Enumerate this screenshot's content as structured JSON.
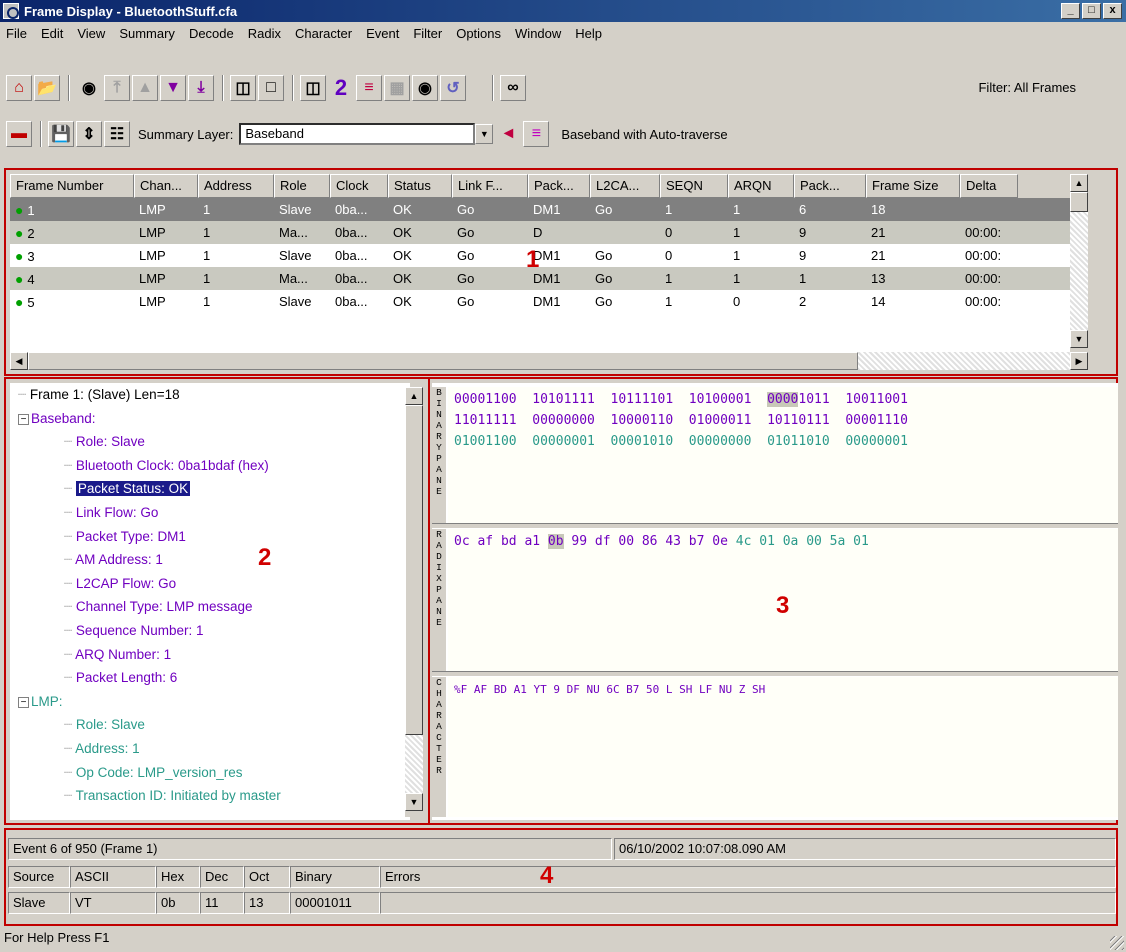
{
  "window": {
    "title": "Frame Display - BluetoothStuff.cfa",
    "buttons": [
      "_",
      "□",
      "x"
    ]
  },
  "menu": [
    "File",
    "Edit",
    "View",
    "Summary",
    "Decode",
    "Radix",
    "Character",
    "Event",
    "Filter",
    "Options",
    "Window",
    "Help"
  ],
  "toolbar": {
    "filter_label": "Filter: All Frames",
    "number_badge": "2"
  },
  "toolbar2": {
    "summary_layer_label": "Summary Layer:",
    "summary_layer_value": "Baseband",
    "traverse_label": "Baseband with Auto-traverse"
  },
  "grid": {
    "columns": [
      "Frame Number",
      "Chan...",
      "Address",
      "Role",
      "Clock",
      "Status",
      "Link F...",
      "Pack...",
      "L2CA...",
      "SEQN",
      "ARQN",
      "Pack...",
      "Frame Size",
      "Delta"
    ],
    "rows": [
      [
        "1",
        "LMP",
        "1",
        "Slave",
        "0ba...",
        "OK",
        "Go",
        "DM1",
        "Go",
        "1",
        "1",
        "6",
        "18",
        ""
      ],
      [
        "2",
        "LMP",
        "1",
        "Ma...",
        "0ba...",
        "OK",
        "Go",
        "D",
        "",
        "0",
        "1",
        "9",
        "21",
        "00:00:"
      ],
      [
        "3",
        "LMP",
        "1",
        "Slave",
        "0ba...",
        "OK",
        "Go",
        "DM1",
        "Go",
        "0",
        "1",
        "9",
        "21",
        "00:00:"
      ],
      [
        "4",
        "LMP",
        "1",
        "Ma...",
        "0ba...",
        "OK",
        "Go",
        "DM1",
        "Go",
        "1",
        "1",
        "1",
        "13",
        "00:00:"
      ],
      [
        "5",
        "LMP",
        "1",
        "Slave",
        "0ba...",
        "OK",
        "Go",
        "DM1",
        "Go",
        "1",
        "0",
        "2",
        "14",
        "00:00:"
      ]
    ]
  },
  "tree": {
    "items": [
      "Frame 1: (Slave) Len=18",
      "Baseband:",
      "Role: Slave",
      "Bluetooth Clock: 0ba1bdaf (hex)",
      "Packet Status: OK",
      "Link Flow: Go",
      "Packet Type: DM1",
      "AM Address: 1",
      "L2CAP Flow: Go",
      "Channel Type: LMP message",
      "Sequence Number: 1",
      "ARQ Number: 1",
      "Packet Length: 6",
      "LMP:",
      "Role: Slave",
      "Address: 1",
      "Op Code: LMP_version_res",
      "Transaction ID: Initiated by master"
    ]
  },
  "binary": {
    "label": "BINARY PANE",
    "lines": [
      "00001100  10101111  10111101  10100001  00001011  10011001",
      "11011111  00000000  10000110  01000011  10110111  00001110",
      "01001100  00000001  00001010  00000000  01011010  00000001"
    ]
  },
  "radix": {
    "label": "RADIX PANE",
    "line_a": "0c af bd a1 ",
    "line_hl": "0b",
    "line_b": " 99 df 00 86 43 b7 0e ",
    "line_c": "4c 01 0a 00 5a 01"
  },
  "character": {
    "label": "CHARACTER",
    "text": "%F AF BD A1 YT 9 DF NU 6C B7 50 L SH LF NU Z SH"
  },
  "status": {
    "event": "Event 6 of 950 (Frame 1)",
    "timestamp": "06/10/2002 10:07:08.090 AM",
    "headers": [
      "Source",
      "ASCII",
      "Hex",
      "Dec",
      "Oct",
      "Binary",
      "Errors"
    ],
    "values": [
      "Slave",
      "VT",
      "0b",
      "11",
      "13",
      "00001011",
      ""
    ]
  },
  "labels": {
    "one": "1",
    "two": "2",
    "three": "3",
    "four": "4"
  },
  "help": "For Help Press F1"
}
